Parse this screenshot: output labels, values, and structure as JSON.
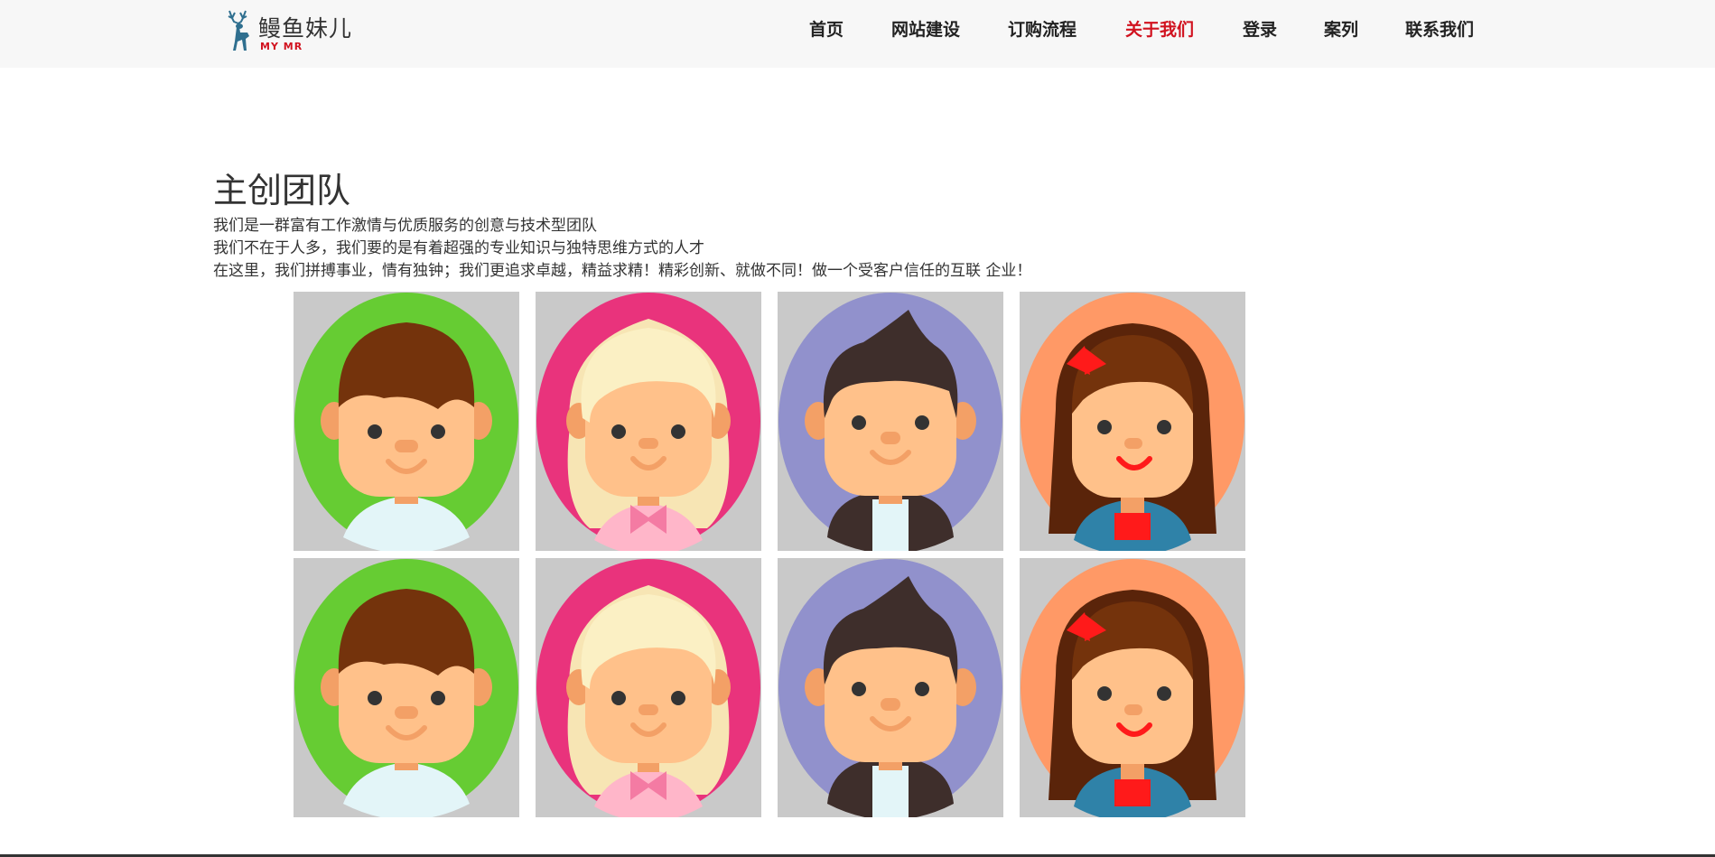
{
  "brand": {
    "name": "鳗鱼妹儿",
    "sub": "MY MR"
  },
  "nav": [
    {
      "label": "首页",
      "active": false
    },
    {
      "label": "网站建设",
      "active": false
    },
    {
      "label": "订购流程",
      "active": false
    },
    {
      "label": "关于我们",
      "active": true
    },
    {
      "label": "登录",
      "active": false
    },
    {
      "label": "案列",
      "active": false
    },
    {
      "label": "联系我们",
      "active": false
    }
  ],
  "section": {
    "title": "主创团队",
    "lines": [
      "我们是一群富有工作激情与优质服务的创意与技术型团队",
      "我们不在于人多，我们要的是有着超强的专业知识与独特思维方式的人才",
      "在这里，我们拼搏事业，情有独钟；我们更追求卓越，精益求精！精彩创新、就做不同！做一个受客户信任的互联 企业！"
    ]
  },
  "team": [
    {
      "avatar": "boy-avatar-green",
      "bg": "#66cc33"
    },
    {
      "avatar": "blonde-girl-avatar-pink",
      "bg": "#e9337c"
    },
    {
      "avatar": "man-avatar-purple",
      "bg": "#9191cc"
    },
    {
      "avatar": "girl-avatar-orange",
      "bg": "#ff9966"
    },
    {
      "avatar": "boy-avatar-green",
      "bg": "#66cc33"
    },
    {
      "avatar": "blonde-girl-avatar-pink",
      "bg": "#e9337c"
    },
    {
      "avatar": "man-avatar-purple",
      "bg": "#9191cc"
    },
    {
      "avatar": "girl-avatar-orange",
      "bg": "#ff9966"
    }
  ],
  "colors": {
    "accent": "#d1121f",
    "topbar": "#f7f7f7",
    "cardBg": "#c9c9c9"
  }
}
